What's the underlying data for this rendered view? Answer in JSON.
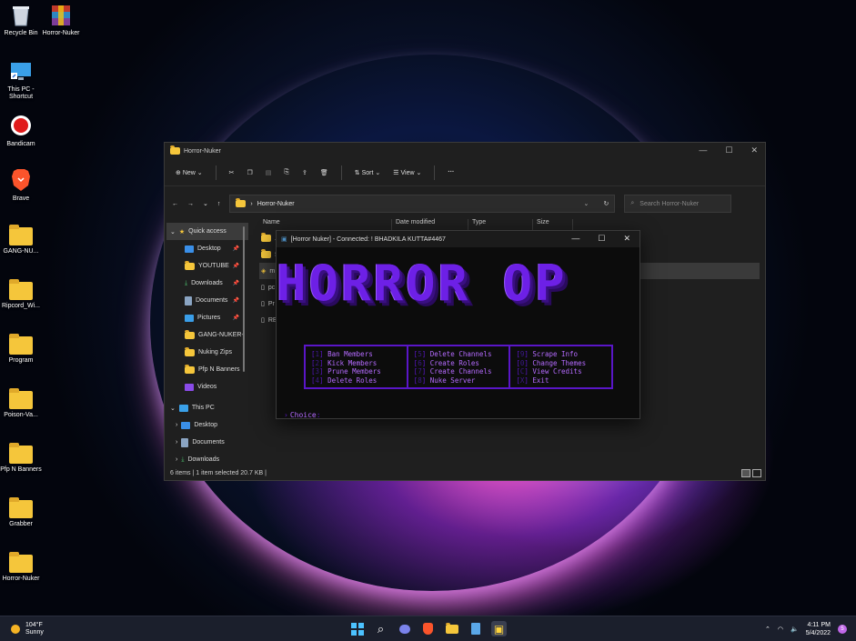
{
  "desktop": {
    "icons": [
      {
        "label": "Recycle Bin",
        "icon": "recycle-bin-icon"
      },
      {
        "label": "Horror-Nuker",
        "icon": "winrar-archive-icon"
      },
      {
        "label": "This PC - Shortcut",
        "icon": "monitor-icon"
      },
      {
        "label": "Bandicam",
        "icon": "record-icon"
      },
      {
        "label": "Brave",
        "icon": "brave-lion-icon"
      },
      {
        "label": "GANG-NU...",
        "icon": "folder-icon"
      },
      {
        "label": "Ripcord_Wi...",
        "icon": "folder-icon"
      },
      {
        "label": "Program",
        "icon": "folder-icon"
      },
      {
        "label": "Poison-Va...",
        "icon": "folder-icon"
      },
      {
        "label": "Pfp N Banners",
        "icon": "folder-icon"
      },
      {
        "label": "Grabber",
        "icon": "folder-icon"
      },
      {
        "label": "Horror-Nuker",
        "icon": "folder-icon"
      }
    ]
  },
  "explorer": {
    "title": "Horror-Nuker",
    "toolbar": {
      "new": "New",
      "sort": "Sort",
      "view": "View"
    },
    "address": "Horror-Nuker",
    "search_placeholder": "Search Horror-Nuker",
    "nav": {
      "quick_access": "Quick access",
      "items": [
        "Desktop",
        "YOUTUBE",
        "Downloads",
        "Documents",
        "Pictures",
        "GANG-NUKER-",
        "Nuking Zips",
        "Pfp N Banners",
        "Videos"
      ],
      "this_pc": "This PC",
      "pc_items": [
        "Desktop",
        "Documents",
        "Downloads"
      ]
    },
    "columns": [
      "Name",
      "Date modified",
      "Type",
      "Size"
    ],
    "files": [
      "._",
      "Sc",
      "m",
      "pc",
      "Pr",
      "RE"
    ],
    "status": "6 items  |  1 item selected  20.7 KB  |"
  },
  "console": {
    "title": "[Horror Nuker] - Connected: ! BHADKILA KUTTA#4467",
    "banner": "HORROR OP",
    "menu": [
      [
        {
          "n": "1",
          "label": "Ban Members"
        },
        {
          "n": "2",
          "label": "Kick Members"
        },
        {
          "n": "3",
          "label": "Prune Members"
        },
        {
          "n": "4",
          "label": "Delete Roles"
        }
      ],
      [
        {
          "n": "5",
          "label": "Delete Channels"
        },
        {
          "n": "6",
          "label": "Create Roles"
        },
        {
          "n": "7",
          "label": "Create Channels"
        },
        {
          "n": "8",
          "label": "Nuke Server"
        }
      ],
      [
        {
          "n": "9",
          "label": "Scrape Info"
        },
        {
          "n": "0",
          "label": "Change Themes"
        },
        {
          "n": "C",
          "label": "View Credits"
        },
        {
          "n": "X",
          "label": "Exit"
        }
      ]
    ],
    "prompt": "Choice"
  },
  "taskbar": {
    "weather_temp": "104°F",
    "weather_desc": "Sunny",
    "time": "4:11 PM",
    "date": "5/4/2022",
    "notification_count": "5"
  }
}
